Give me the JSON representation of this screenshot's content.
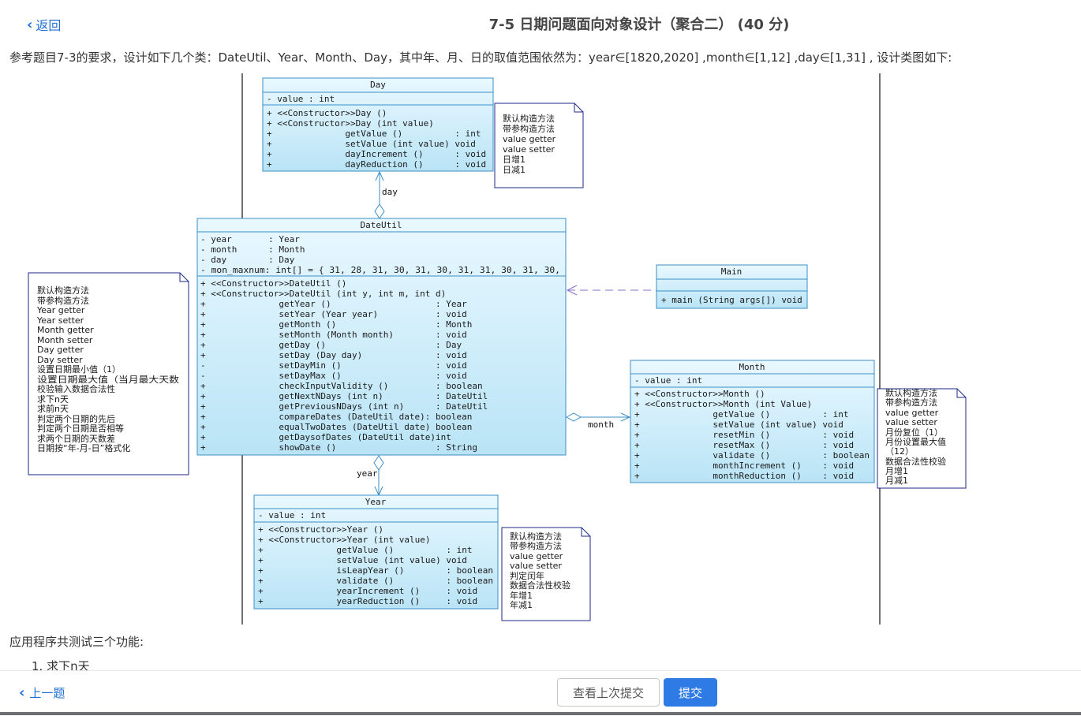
{
  "nav": {
    "back_label": "返回",
    "prev_label": "上一题"
  },
  "problem": {
    "title": "7-5 日期问题面向对象设计（聚合二） (40 分)",
    "description": "参考题目7-3的要求，设计如下几个类：DateUtil、Year、Month、Day，其中年、月、日的取值范围依然为：year∈[1820,2020] ,month∈[1,12] ,day∈[1,31] , 设计类图如下:",
    "app_text": "应用程序共测试三个功能:",
    "list_item_1": "1. 求下n天"
  },
  "buttons": {
    "history": "查看上次提交",
    "submit": "提交"
  },
  "uml": {
    "day": {
      "name": "Day",
      "attrs": [
        "- value : int"
      ],
      "ops": [
        "+ <<Constructor>>Day ()",
        "+ <<Constructor>>Day (int value)",
        "+              getValue ()          : int",
        "+              setValue (int value) void",
        "+              dayIncrement ()      : void",
        "+              dayReduction ()      : void"
      ]
    },
    "dateutil": {
      "name": "DateUtil",
      "attrs": [
        "- year       : Year",
        "- month      : Month",
        "- day        : Day",
        "- mon_maxnum: int[] = { 31, 28, 31, 30, 31, 30, 31, 31, 30, 31, 30,"
      ],
      "ops": [
        "+ <<Constructor>>DateUtil ()",
        "+ <<Constructor>>DateUtil (int y, int m, int d)",
        "+              getYear ()                    : Year",
        "+              setYear (Year year)           : void",
        "+              getMonth ()                   : Month",
        "+              setMonth (Month month)        : void",
        "+              getDay ()                     : Day",
        "+              setDay (Day day)              : void",
        "-              setDayMin ()                  : void",
        "-              setDayMax ()                  : void",
        "+              checkInputValidity ()         : boolean",
        "+              getNextNDays (int n)          : DateUtil",
        "+              getPreviousNDays (int n)      : DateUtil",
        "+              compareDates (DateUtil date): boolean",
        "+              equalTwoDates (DateUtil date) boolean",
        "+              getDaysofDates (DateUtil date)int",
        "+              showDate ()                   : String"
      ]
    },
    "main": {
      "name": "Main",
      "ops": [
        "+ main (String args[]) void"
      ]
    },
    "month": {
      "name": "Month",
      "attrs": [
        "- value : int"
      ],
      "ops": [
        "+ <<Constructor>>Month ()",
        "+ <<Constructor>>Month (int Value)",
        "+              getValue ()          : int",
        "+              setValue (int value) void",
        "+              resetMin ()          : void",
        "+              resetMax ()          : void",
        "+              validate ()          : boolean",
        "+              monthIncrement ()    : void",
        "+              monthReduction ()    : void"
      ]
    },
    "year": {
      "name": "Year",
      "attrs": [
        "- value : int"
      ],
      "ops": [
        "+ <<Constructor>>Year ()",
        "+ <<Constructor>>Year (int value)",
        "+              getValue ()          : int",
        "+              setValue (int value) void",
        "+              isLeapYear ()        : boolean",
        "+              validate ()          : boolean",
        "+              yearIncrement ()     : void",
        "+              yearReduction ()     : void"
      ]
    },
    "assoc_labels": {
      "day": "day",
      "month": "month",
      "year": "year"
    },
    "notes": {
      "day": [
        "默认构造方法",
        "带参构造方法",
        "value getter",
        "value setter",
        "日增1",
        "日减1"
      ],
      "dateutil": [
        "默认构造方法",
        "带参构造方法",
        "Year getter",
        "Year setter",
        "Month getter",
        "Month setter",
        "Day getter",
        "Day setter",
        "设置日期最小值（1）",
        "设置日期最大值（当月最大天数",
        "校验输入数据合法性",
        "求下n天",
        "求前n天",
        "判定两个日期的先后",
        "判定两个日期是否相等",
        "求两个日期的天数差",
        "日期按“年-月-日”格式化"
      ],
      "month": [
        "默认构造方法",
        "带参构造方法",
        "value getter",
        "value setter",
        "月份复位（1）",
        "月份设置最大值",
        "（12）",
        "数据合法性校验",
        "月增1",
        "月减1"
      ],
      "year": [
        "默认构造方法",
        "带参构造方法",
        "value getter",
        "value setter",
        "判定闰年",
        "数据合法性校验",
        "年增1",
        "年减1"
      ]
    }
  },
  "colors": {
    "accent": "#1f6fd6",
    "submit": "#2f7be5",
    "uml_fill": "#c5eaf8",
    "uml_border": "#3a8fc8",
    "note_border": "#1b2a8a"
  }
}
